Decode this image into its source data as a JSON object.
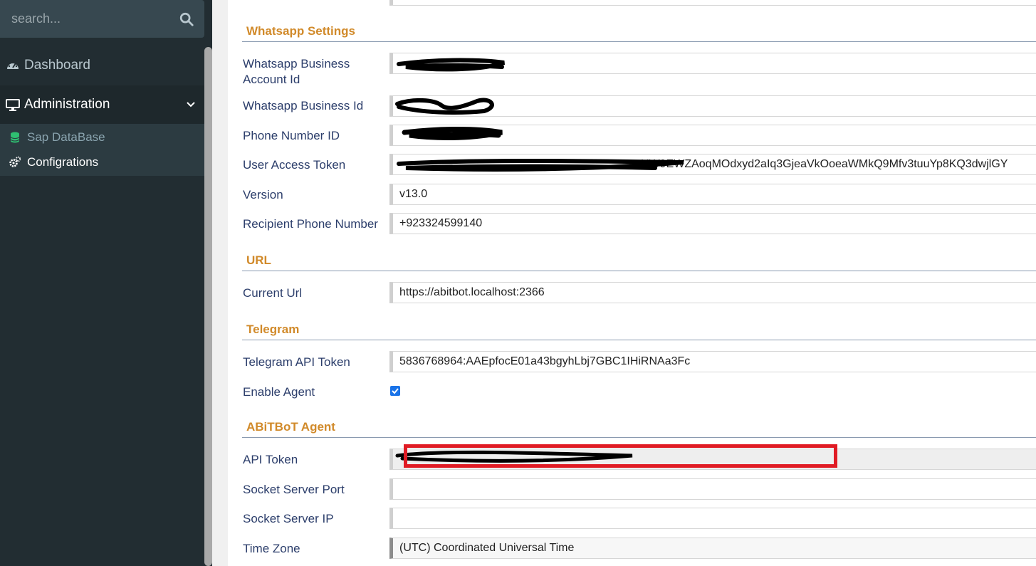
{
  "sidebar": {
    "search_placeholder": "search...",
    "items": [
      {
        "label": "Dashboard",
        "icon": "dashboard-icon"
      },
      {
        "label": "Administration",
        "icon": "desktop-icon"
      }
    ],
    "submenu": [
      {
        "label": "Sap DataBase",
        "icon": "database-icon"
      },
      {
        "label": "Configrations",
        "icon": "gears-icon"
      }
    ]
  },
  "sections": {
    "whatsapp": "Whatsapp Settings",
    "url": "URL",
    "telegram": "Telegram",
    "agent": "ABiTBoT Agent"
  },
  "fields": {
    "wa_account_id_label": "Whatsapp Business Account Id",
    "wa_account_id_value": "",
    "wa_business_id_label": "Whatsapp Business Id",
    "wa_business_id_value": "",
    "phone_number_id_label": "Phone Number ID",
    "phone_number_id_value": "",
    "user_access_token_label": "User Access Token",
    "user_access_token_value": "HW9EWZAoqMOdxyd2aIq3GjeaVkOoeaWMkQ9Mfv3tuuYp8KQ3dwjlGY",
    "version_label": "Version",
    "version_value": "v13.0",
    "recipient_label": "Recipient Phone Number",
    "recipient_value": "+923324599140",
    "current_url_label": "Current Url",
    "current_url_value": "https://abitbot.localhost:2366",
    "telegram_token_label": "Telegram API Token",
    "telegram_token_value": "5836768964:AAEpfocE01a43bgyhLbj7GBC1IHiRNAa3Fc",
    "enable_agent_label": "Enable Agent",
    "enable_agent_checked": true,
    "api_token_label": "API Token",
    "api_token_value": "",
    "socket_port_label": "Socket Server Port",
    "socket_port_value": "",
    "socket_ip_label": "Socket Server IP",
    "socket_ip_value": "",
    "timezone_label": "Time Zone",
    "timezone_value": "(UTC) Coordinated Universal Time"
  },
  "colors": {
    "sidebar_bg": "#222d32",
    "section_title": "#d18a2a",
    "label_text": "#2c3e6b",
    "highlight_red": "#e01b24",
    "checkbox_blue": "#1a73e8"
  }
}
